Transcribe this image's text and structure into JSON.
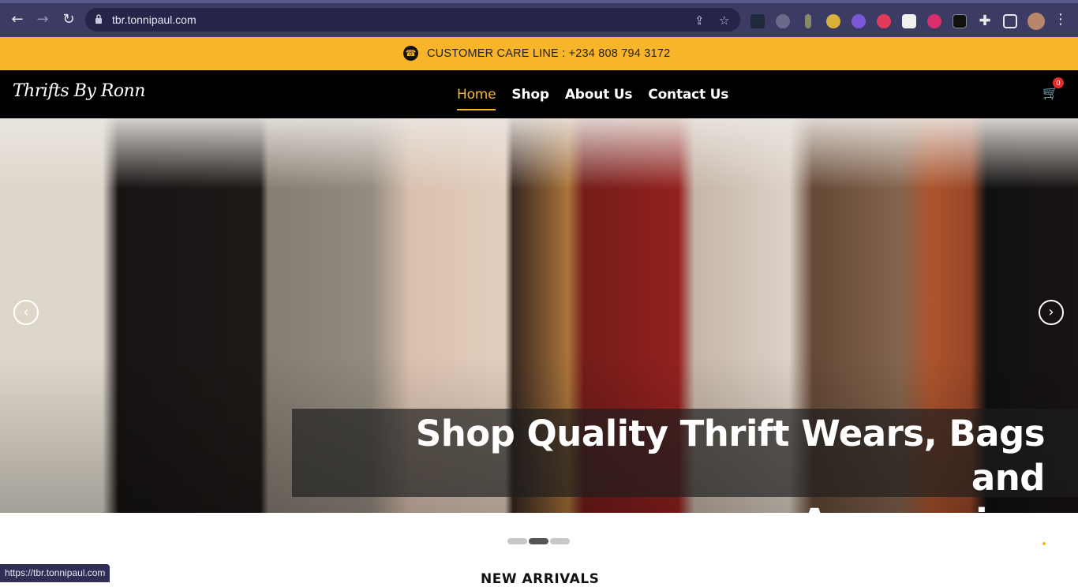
{
  "browser": {
    "url": "tbr.tonnipaul.com",
    "status_url": "https://tbr.tonnipaul.com"
  },
  "topbar": {
    "care_line": "CUSTOMER CARE LINE : +234 808 794 3172"
  },
  "header": {
    "logo_text": "Thrifts By Ronn",
    "nav": [
      {
        "label": "Home",
        "active": true
      },
      {
        "label": "Shop",
        "active": false
      },
      {
        "label": "About Us",
        "active": false
      },
      {
        "label": "Contact Us",
        "active": false
      }
    ],
    "cart_count": "0"
  },
  "hero": {
    "caption_line1": "Shop Quality Thrift Wears, Bags and",
    "caption_line2": "Accessories.",
    "slide_count": 3,
    "active_slide": 2
  },
  "section": {
    "title": "NEW ARRIVALS"
  },
  "colors": {
    "accent": "#f9b52a",
    "header_bg": "#000000",
    "badge": "#e32b2b"
  }
}
